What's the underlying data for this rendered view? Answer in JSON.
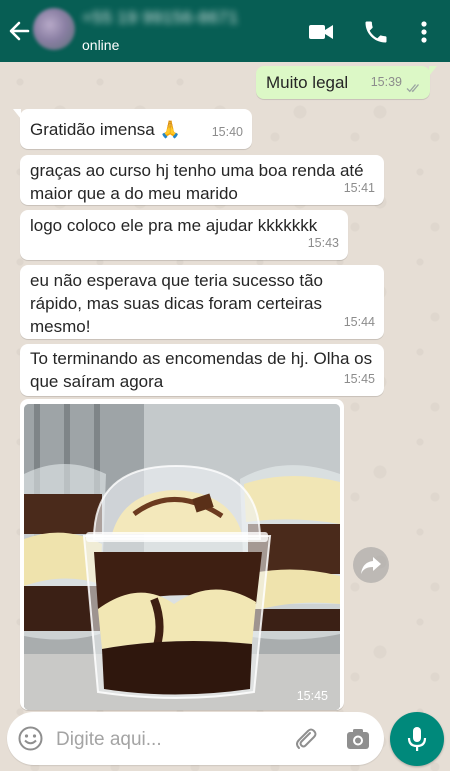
{
  "header": {
    "contact_name": "+55 19 99156-8671",
    "status": "online"
  },
  "messages": [
    {
      "direction": "out",
      "text": "Muito legal",
      "time": "15:39"
    },
    {
      "direction": "in",
      "text": "Gratidão imensa 🙏",
      "time": "15:40"
    },
    {
      "direction": "in",
      "text": "graças ao curso hj tenho uma boa renda até maior que a do meu marido",
      "time": "15:41"
    },
    {
      "direction": "in",
      "text": "logo coloco ele pra me ajudar kkkkkkk",
      "time": "15:43"
    },
    {
      "direction": "in",
      "text": "eu não esperava que teria sucesso tão rápido, mas suas dicas foram certeiras mesmo!",
      "time": "15:44"
    },
    {
      "direction": "in",
      "text": "To terminando as encomendas de hj. Olha os que saíram agora",
      "time": "15:45"
    },
    {
      "direction": "in",
      "type": "image",
      "time": "15:45"
    }
  ],
  "composer": {
    "placeholder": "Digite aqui..."
  },
  "colors": {
    "header": "#075e54",
    "outgoing_bubble": "#dcf8c6",
    "incoming_bubble": "#ffffff",
    "mic_button": "#00897b",
    "read_ticks": "#9aa4a1"
  },
  "icons": [
    "back-arrow-icon",
    "video-call-icon",
    "phone-icon",
    "more-vert-icon",
    "read-ticks-icon",
    "forward-icon",
    "emoji-icon",
    "paperclip-icon",
    "camera-icon",
    "mic-icon"
  ]
}
